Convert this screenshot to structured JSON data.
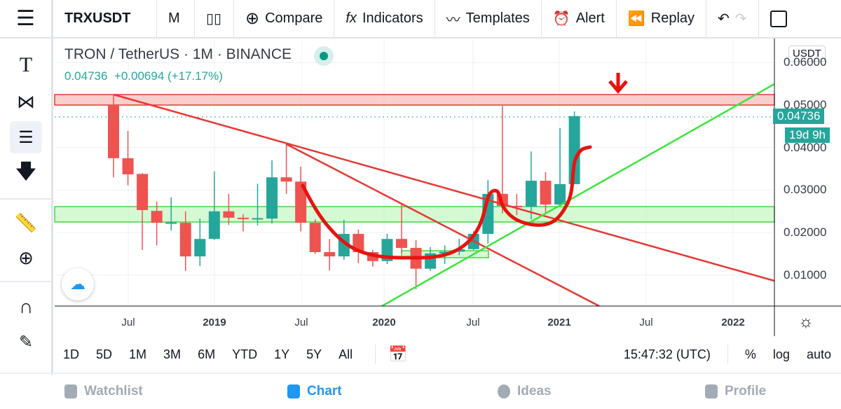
{
  "toolbar": {
    "symbol": "TRXUSDT",
    "interval": "M",
    "compare": "Compare",
    "indicators": "Indicators",
    "templates": "Templates",
    "alert": "Alert",
    "replay": "Replay"
  },
  "legend": {
    "title": "TRON / TetherUS · 1M · BINANCE",
    "last": "0.04736",
    "change": "+0.00694 (+17.17%)"
  },
  "price_axis": {
    "currency": "USDT",
    "ticks": [
      "0.06000",
      "0.05000",
      "0.04000",
      "0.03000",
      "0.02000",
      "0.01000"
    ],
    "last_price": "0.04736",
    "countdown": "19d 9h"
  },
  "time_axis": {
    "ticks": [
      "Jul",
      "2019",
      "Jul",
      "2020",
      "Jul",
      "2021",
      "Jul",
      "2022"
    ]
  },
  "left_tools": [
    "text-icon",
    "pattern-icon",
    "trendline-tools-icon",
    "arrow-down-icon",
    "ruler-icon",
    "zoom-in-icon",
    "magnet-icon",
    "lock-drawing-icon"
  ],
  "ranges": [
    "1D",
    "5D",
    "1M",
    "3M",
    "6M",
    "YTD",
    "1Y",
    "5Y",
    "All"
  ],
  "bottom": {
    "time": "15:47:32 (UTC)",
    "percent": "%",
    "log": "log",
    "auto": "auto"
  },
  "nav": {
    "watchlist": "Watchlist",
    "chart": "Chart",
    "ideas": "Ideas",
    "profile": "Profile"
  },
  "colors": {
    "up": "#26a69a",
    "down": "#ef5350",
    "accent": "#2196f3",
    "resistance_zone": "#ef5350",
    "support_zone": "#4ce64c"
  },
  "chart_data": {
    "type": "candlestick",
    "interval": "1M",
    "start": "2018-06",
    "ylim": [
      0.003,
      0.065
    ],
    "grid": true,
    "ohlc": [
      [
        0.05,
        0.0525,
        0.033,
        0.0375
      ],
      [
        0.0375,
        0.0439,
        0.0311,
        0.0337
      ],
      [
        0.0338,
        0.034,
        0.0159,
        0.0253
      ],
      [
        0.0251,
        0.0273,
        0.017,
        0.0223
      ],
      [
        0.0222,
        0.0283,
        0.0205,
        0.0224
      ],
      [
        0.0223,
        0.025,
        0.011,
        0.0144
      ],
      [
        0.0144,
        0.0233,
        0.0121,
        0.0185
      ],
      [
        0.0185,
        0.0344,
        0.0183,
        0.025
      ],
      [
        0.025,
        0.0291,
        0.0218,
        0.0235
      ],
      [
        0.0235,
        0.0243,
        0.0203,
        0.0234
      ],
      [
        0.0233,
        0.0315,
        0.0217,
        0.0234
      ],
      [
        0.0233,
        0.037,
        0.0221,
        0.033
      ],
      [
        0.033,
        0.0408,
        0.0291,
        0.032
      ],
      [
        0.032,
        0.0355,
        0.0203,
        0.0223
      ],
      [
        0.0223,
        0.0231,
        0.015,
        0.0154
      ],
      [
        0.0154,
        0.0185,
        0.0111,
        0.0144
      ],
      [
        0.0144,
        0.023,
        0.0136,
        0.0197
      ],
      [
        0.0197,
        0.0207,
        0.0128,
        0.0154
      ],
      [
        0.0154,
        0.0159,
        0.012,
        0.0133
      ],
      [
        0.0133,
        0.0197,
        0.0126,
        0.0185
      ],
      [
        0.0185,
        0.0266,
        0.0151,
        0.0164
      ],
      [
        0.0164,
        0.0182,
        0.0067,
        0.0115
      ],
      [
        0.0115,
        0.0166,
        0.011,
        0.0151
      ],
      [
        0.0151,
        0.017,
        0.0126,
        0.0155
      ],
      [
        0.0155,
        0.0185,
        0.0147,
        0.0161
      ],
      [
        0.0161,
        0.0203,
        0.0159,
        0.0197
      ],
      [
        0.0197,
        0.0324,
        0.0174,
        0.0291
      ],
      [
        0.0291,
        0.0498,
        0.0245,
        0.0263
      ],
      [
        0.0263,
        0.0291,
        0.0241,
        0.0261
      ],
      [
        0.0261,
        0.0391,
        0.0231,
        0.0322
      ],
      [
        0.0322,
        0.0342,
        0.0245,
        0.0266
      ],
      [
        0.0266,
        0.0446,
        0.0264,
        0.0314
      ],
      [
        0.0314,
        0.0485,
        0.0314,
        0.0474
      ]
    ],
    "zones": {
      "resistance": [
        0.05,
        0.0525
      ],
      "support": [
        0.0225,
        0.0261
      ]
    }
  }
}
